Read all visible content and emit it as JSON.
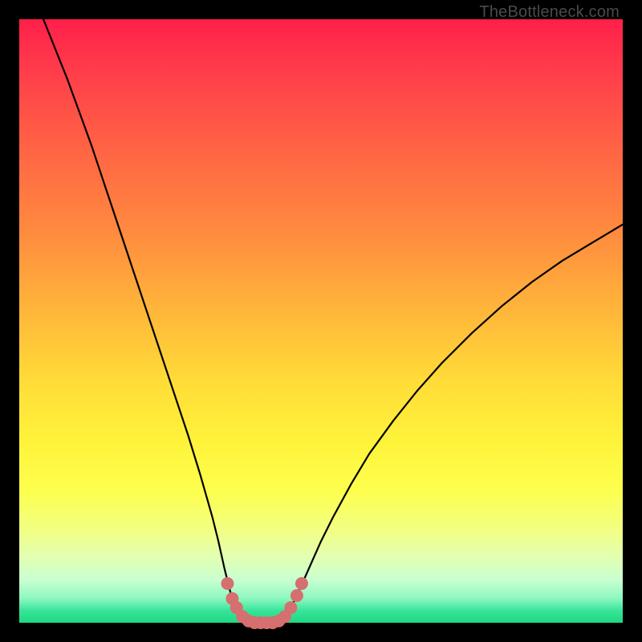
{
  "watermark": {
    "text": "TheBottleneck.com"
  },
  "colors": {
    "curve_stroke": "#000000",
    "marker_stroke": "#d66f6f",
    "marker_fill": "#d66f6f",
    "frame_bg": "#000000"
  },
  "chart_data": {
    "type": "line",
    "title": "",
    "xlabel": "",
    "ylabel": "",
    "xlim": [
      0,
      100
    ],
    "ylim": [
      0,
      100
    ],
    "grid": false,
    "legend": false,
    "series": [
      {
        "name": "bottleneck-curve",
        "x": [
          4,
          6,
          8,
          10,
          12,
          14,
          16,
          18,
          20,
          22,
          24,
          26,
          28,
          30,
          32,
          33,
          34,
          35,
          36,
          37,
          38,
          39,
          40,
          41,
          42,
          43,
          44,
          45,
          46,
          48,
          50,
          52,
          55,
          58,
          62,
          66,
          70,
          75,
          80,
          85,
          90,
          95,
          100
        ],
        "y": [
          100,
          95,
          90,
          84.5,
          79,
          73,
          67,
          61,
          55,
          49,
          43,
          37,
          31,
          24.5,
          17.5,
          13.5,
          9,
          5,
          2.5,
          1,
          0.3,
          0,
          0,
          0,
          0,
          0.3,
          1,
          2.5,
          4.5,
          9,
          13.5,
          17.5,
          23,
          28,
          33.5,
          38.5,
          43,
          48,
          52.5,
          56.5,
          60,
          63,
          66
        ]
      }
    ],
    "markers": {
      "name": "highlight-dots",
      "x": [
        34.5,
        35.3,
        36,
        37,
        38,
        39,
        40,
        41,
        42,
        43,
        44,
        45,
        46,
        46.8
      ],
      "y": [
        6.5,
        4,
        2.5,
        1,
        0.3,
        0,
        0,
        0,
        0,
        0.3,
        1,
        2.5,
        4.5,
        6.5
      ]
    }
  }
}
